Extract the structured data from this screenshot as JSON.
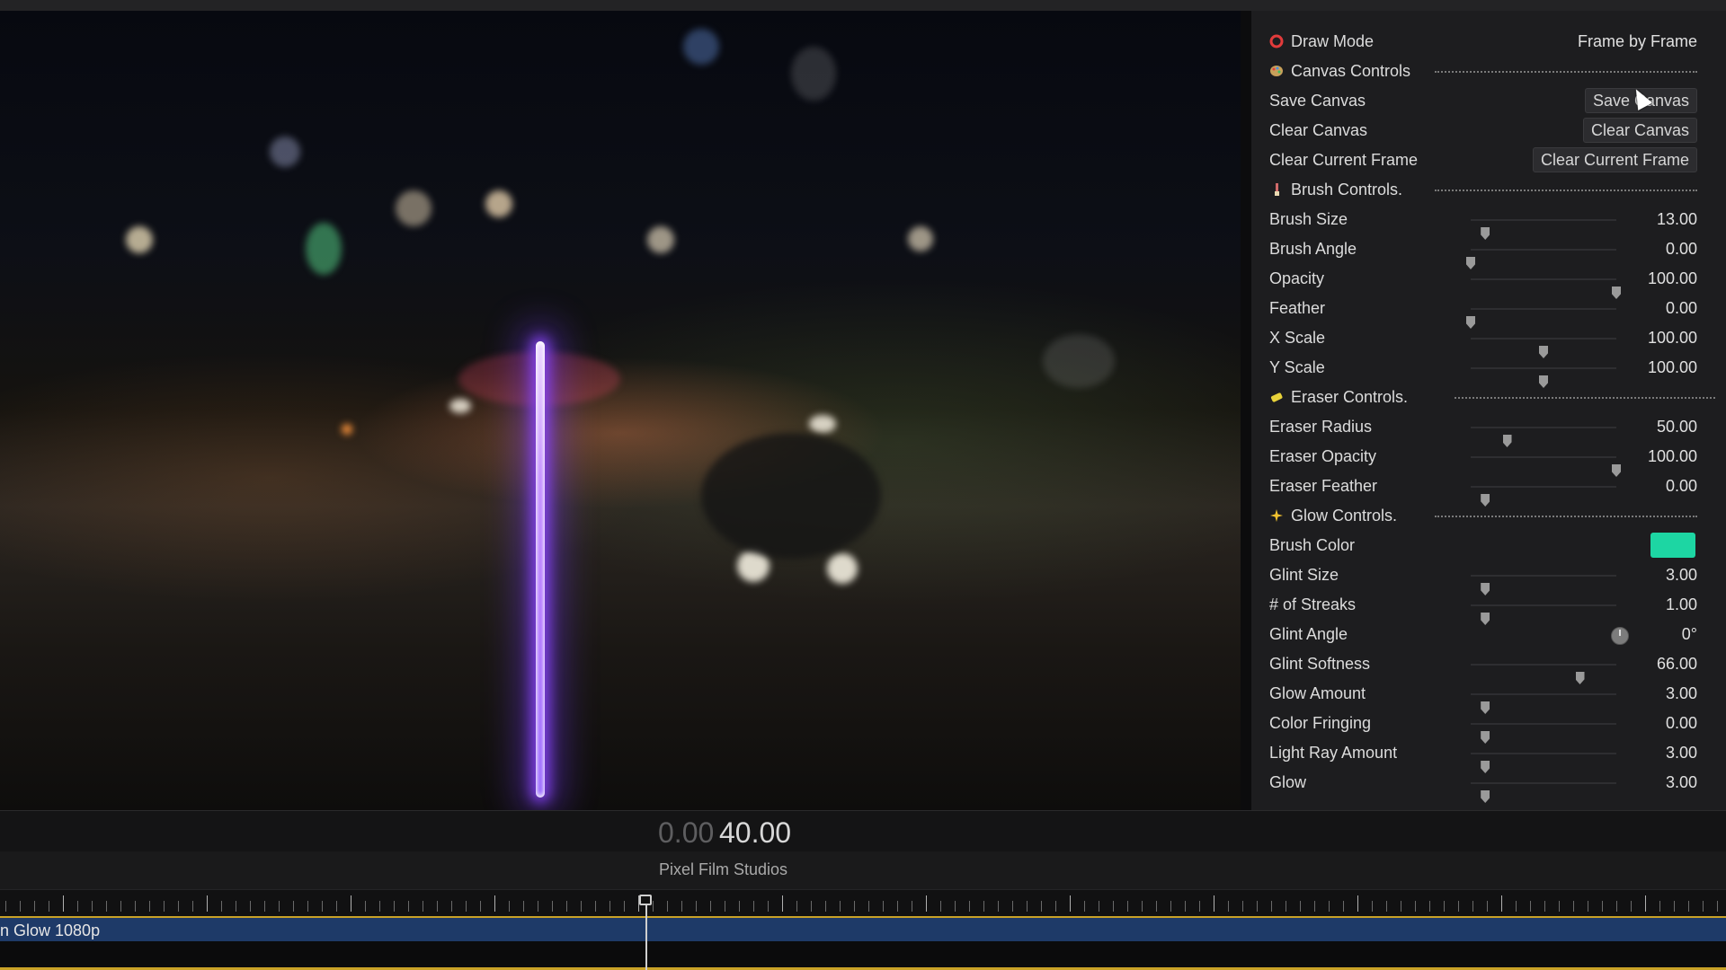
{
  "viewer": {
    "brush_stroke_color": "#9b4dff"
  },
  "panel": {
    "draw_mode": {
      "label": "Draw Mode",
      "value": "Frame by Frame",
      "icon": "record-circle-icon"
    },
    "canvas_controls": {
      "label": "Canvas Controls",
      "icon": "palette-icon"
    },
    "save_canvas": {
      "label": "Save Canvas",
      "button": "Save Canvas"
    },
    "clear_canvas": {
      "label": "Clear Canvas",
      "button": "Clear Canvas"
    },
    "clear_current_frame": {
      "label": "Clear Current Frame",
      "button": "Clear Current Frame"
    },
    "brush_controls": {
      "label": "Brush Controls.",
      "icon": "brush-icon"
    },
    "brush_size": {
      "label": "Brush Size",
      "value": "13.00",
      "fraction": 0.1
    },
    "brush_angle": {
      "label": "Brush Angle",
      "value": "0.00",
      "fraction": 0.0
    },
    "opacity": {
      "label": "Opacity",
      "value": "100.00",
      "fraction": 1.0
    },
    "feather": {
      "label": "Feather",
      "value": "0.00",
      "fraction": 0.0
    },
    "x_scale": {
      "label": "X Scale",
      "value": "100.00",
      "fraction": 0.5
    },
    "y_scale": {
      "label": "Y Scale",
      "value": "100.00",
      "fraction": 0.5
    },
    "eraser_controls": {
      "label": "Eraser Controls.",
      "icon": "eraser-icon"
    },
    "eraser_radius": {
      "label": "Eraser Radius",
      "value": "50.00",
      "fraction": 0.25
    },
    "eraser_opacity": {
      "label": "Eraser Opacity",
      "value": "100.00",
      "fraction": 1.0
    },
    "eraser_feather": {
      "label": "Eraser Feather",
      "value": "0.00",
      "fraction": 0.1
    },
    "glow_controls": {
      "label": "Glow Controls.",
      "icon": "sparkle-icon"
    },
    "brush_color": {
      "label": "Brush Color",
      "color": "#1dd6a3"
    },
    "glint_size": {
      "label": "Glint Size",
      "value": "3.00",
      "fraction": 0.1
    },
    "streaks": {
      "label": "# of Streaks",
      "value": "1.00",
      "fraction": 0.1
    },
    "glint_angle": {
      "label": "Glint Angle",
      "value": "0°"
    },
    "glint_softness": {
      "label": "Glint Softness",
      "value": "66.00",
      "fraction": 0.75
    },
    "glow_amount": {
      "label": "Glow Amount",
      "value": "3.00",
      "fraction": 0.1
    },
    "color_fringing": {
      "label": "Color Fringing",
      "value": "0.00",
      "fraction": 0.1
    },
    "light_ray_amount": {
      "label": "Light Ray Amount",
      "value": "3.00",
      "fraction": 0.1
    },
    "glow": {
      "label": "Glow",
      "value": "3.00",
      "fraction": 0.1
    }
  },
  "timeline": {
    "timecode_dim": "0.00",
    "timecode_bright": "40.00",
    "studio": "Pixel Film Studios",
    "clip_name": "n Glow 1080p",
    "accent": "#c9a227",
    "clip_color": "#1e3a68"
  }
}
